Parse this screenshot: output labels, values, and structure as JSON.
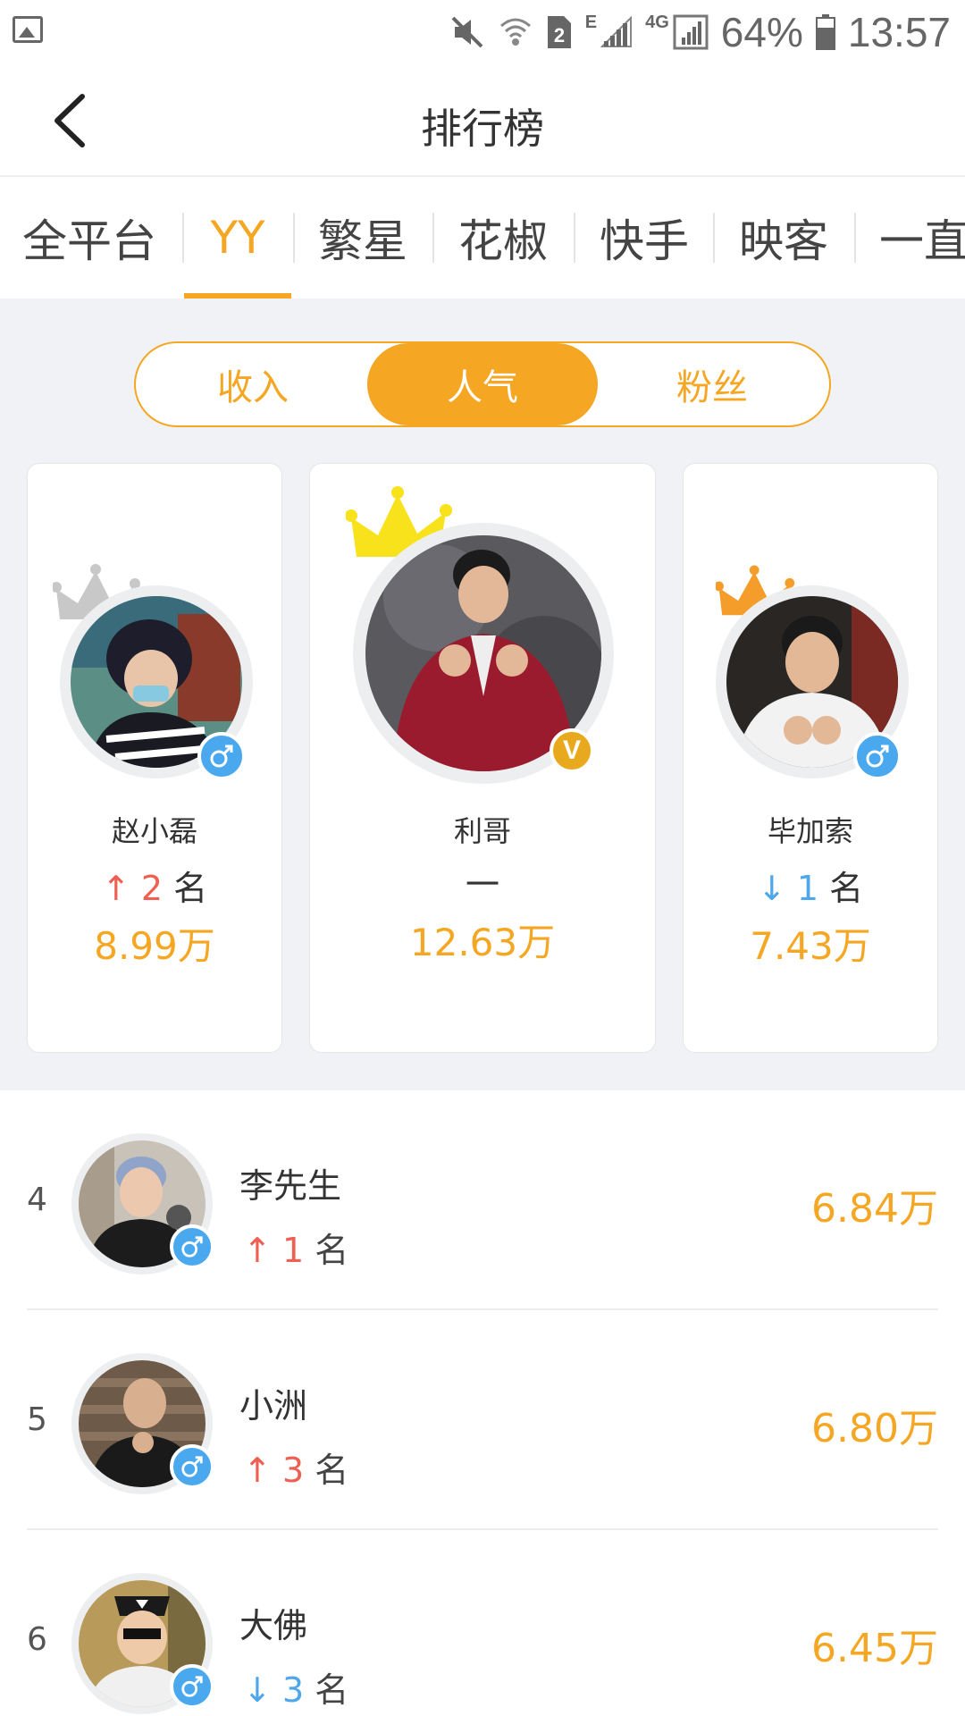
{
  "status_bar": {
    "network_label": "4G",
    "edge_label": "E",
    "sim_label": "2",
    "battery": "64%",
    "time": "13:57",
    "icons": [
      "gallery-icon",
      "mute-icon",
      "wifi-icon",
      "sim-icon",
      "signal-icon",
      "signal-icon",
      "battery-icon"
    ]
  },
  "nav": {
    "title": "排行榜",
    "back_icon": "chevron-left-icon"
  },
  "platform_tabs": [
    {
      "label": "全平台",
      "active": false
    },
    {
      "label": "YY",
      "active": true
    },
    {
      "label": "繁星",
      "active": false
    },
    {
      "label": "花椒",
      "active": false
    },
    {
      "label": "快手",
      "active": false
    },
    {
      "label": "映客",
      "active": false
    },
    {
      "label": "一直",
      "active": false
    }
  ],
  "segments": [
    {
      "label": "收入",
      "active": false
    },
    {
      "label": "人气",
      "active": true
    },
    {
      "label": "粉丝",
      "active": false
    }
  ],
  "podium": [
    {
      "place": 2,
      "name": "赵小磊",
      "rank_arrow": "↑",
      "rank_change": "2",
      "rank_unit": "名",
      "value": "8.99万",
      "crown_color": "#c8c8c8",
      "badge": "male-icon"
    },
    {
      "place": 1,
      "name": "利哥",
      "rank_text": "一",
      "value": "12.63万",
      "crown_color": "#f7e21b",
      "badge": "V"
    },
    {
      "place": 3,
      "name": "毕加索",
      "rank_arrow": "↓",
      "rank_change": "1",
      "rank_unit": "名",
      "value": "7.43万",
      "crown_color": "#f49d2a",
      "badge": "male-icon"
    }
  ],
  "list": [
    {
      "index": "4",
      "name": "李先生",
      "rank_arrow": "↑",
      "rank_change": "1",
      "rank_unit": "名",
      "value": "6.84万",
      "direction": "up"
    },
    {
      "index": "5",
      "name": "小洲",
      "rank_arrow": "↑",
      "rank_change": "3",
      "rank_unit": "名",
      "value": "6.80万",
      "direction": "up"
    },
    {
      "index": "6",
      "name": "大佛",
      "rank_arrow": "↓",
      "rank_change": "3",
      "rank_unit": "名",
      "value": "6.45万",
      "direction": "down"
    }
  ],
  "colors": {
    "accent": "#f5a623",
    "up": "#ef5f52",
    "down": "#4ea7ea",
    "male_badge": "#4aa8ee",
    "background": "#f1f2f6"
  }
}
